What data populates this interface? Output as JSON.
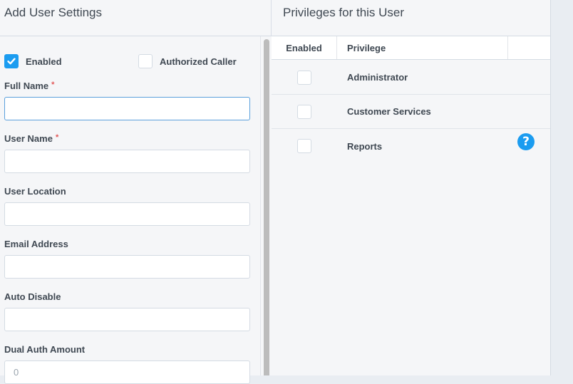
{
  "left_panel": {
    "title": "Add User Settings",
    "checkboxes": [
      {
        "label": "Enabled",
        "checked": true
      },
      {
        "label": "Authorized Caller",
        "checked": false
      }
    ],
    "fields": [
      {
        "label": "Full Name",
        "required": true,
        "value": "",
        "placeholder": "",
        "focused": true
      },
      {
        "label": "User Name",
        "required": true,
        "value": "",
        "placeholder": ""
      },
      {
        "label": "User Location",
        "required": false,
        "value": "",
        "placeholder": ""
      },
      {
        "label": "Email Address",
        "required": false,
        "value": "",
        "placeholder": ""
      },
      {
        "label": "Auto Disable",
        "required": false,
        "value": "",
        "placeholder": ""
      },
      {
        "label": "Dual Auth Amount",
        "required": false,
        "value": "",
        "placeholder": "0"
      }
    ],
    "required_marker": "*"
  },
  "right_panel": {
    "title": "Privileges for this User",
    "columns": [
      "Enabled",
      "Privilege",
      ""
    ],
    "rows": [
      {
        "privilege": "Administrator",
        "enabled": false
      },
      {
        "privilege": "Customer Services",
        "enabled": false
      },
      {
        "privilege": "Reports",
        "enabled": false
      }
    ],
    "help_icon": "question-circle-icon",
    "help_glyph": "?"
  },
  "colors": {
    "accent": "#1b9cf0",
    "required": "#e25656",
    "panel_bg": "#f5f6f8"
  }
}
